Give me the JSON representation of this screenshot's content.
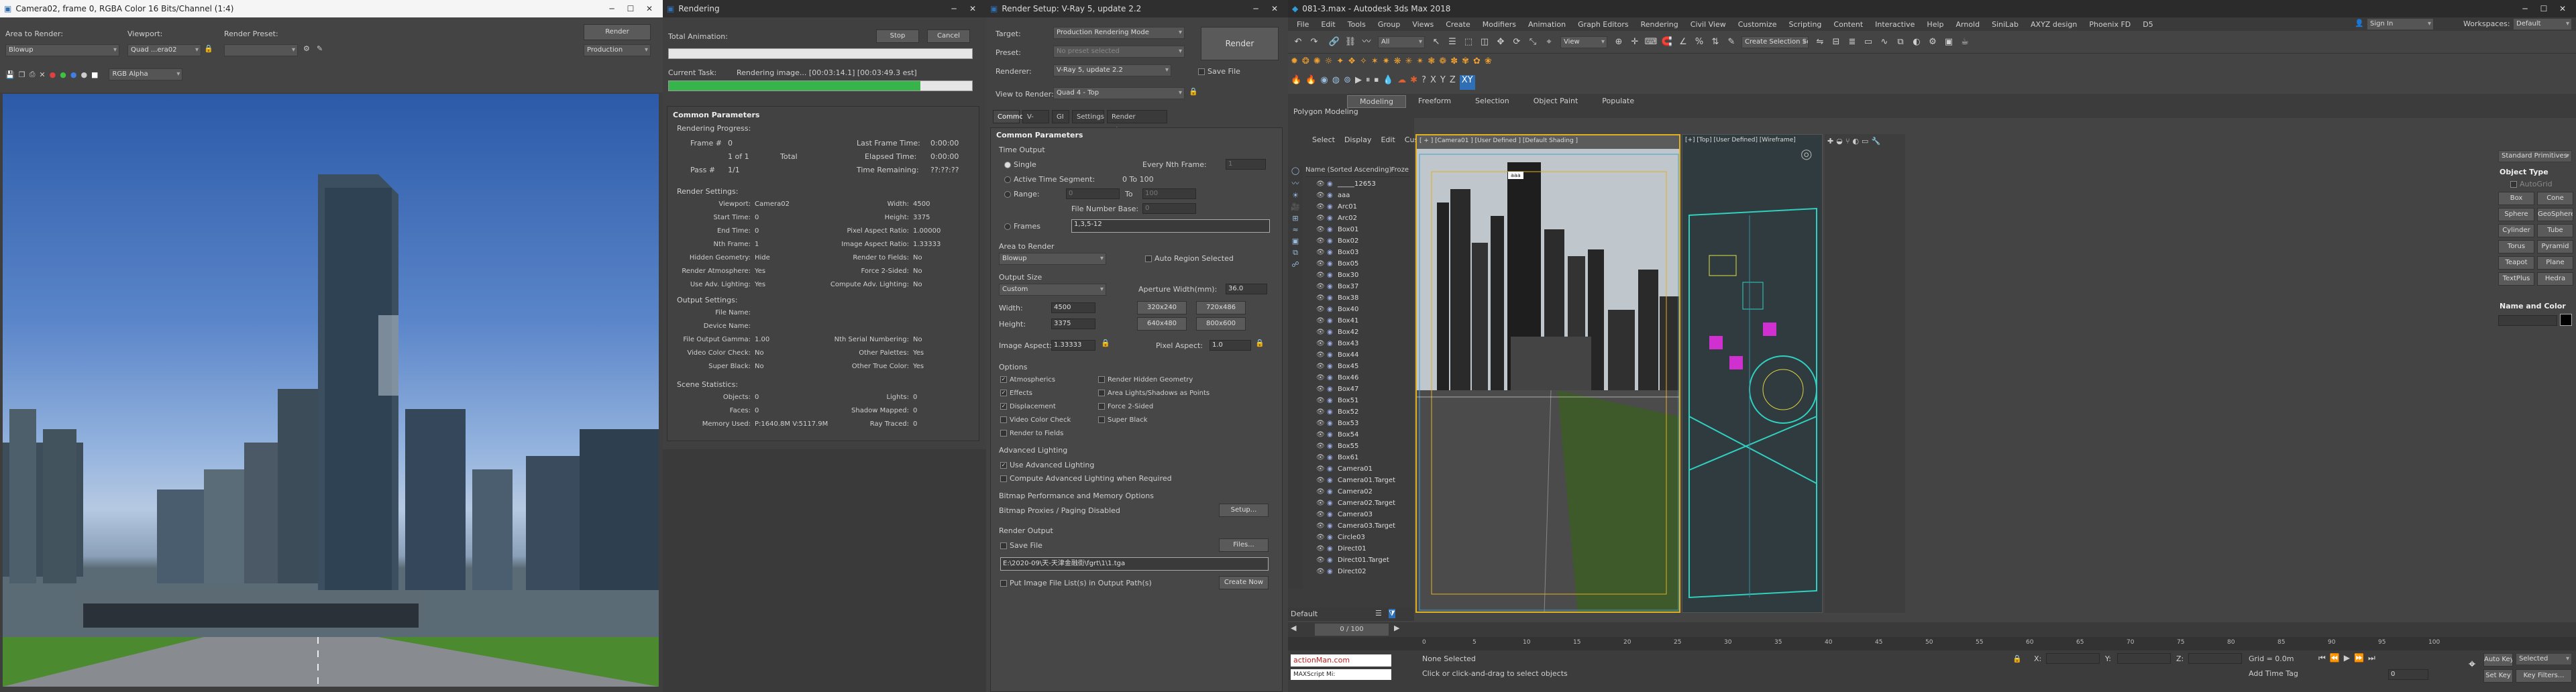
{
  "frame_buffer": {
    "title": "Camera02, frame 0, RGBA Color 16 Bits/Channel (1:4)",
    "area_to_render_label": "Area to Render:",
    "area_to_render_value": "Blowup",
    "viewport_label": "Viewport:",
    "viewport_value": "Quad ...era02",
    "render_preset_label": "Render Preset:",
    "render_preset_value": "",
    "render_button": "Render",
    "production_value": "Production",
    "channel_value": "RGB Alpha"
  },
  "rendering_dialog": {
    "title": "Rendering",
    "total_animation_label": "Total Animation:",
    "stop_button": "Stop",
    "cancel_button": "Cancel",
    "total_progress": 0.0,
    "current_task_label": "Current Task:",
    "current_task_value": "Rendering image... [00:03:14.1] [00:03:49.3 est]",
    "task_progress": 0.83,
    "section_title": "Common Parameters",
    "rendering_progress_label": "Rendering Progress:",
    "frame_label": "Frame #",
    "frame_value": "0",
    "of_value": "1 of 1",
    "total_label": "Total",
    "pass_label": "Pass #",
    "pass_value": "1/1",
    "last_frame_time_label": "Last Frame Time:",
    "last_frame_time_value": "0:00:00",
    "elapsed_time_label": "Elapsed Time:",
    "elapsed_time_value": "0:00:00",
    "time_remaining_label": "Time Remaining:",
    "time_remaining_value": "??:??:??",
    "render_settings_label": "Render Settings:",
    "settings": [
      {
        "k": "Viewport:",
        "v": "Camera02"
      },
      {
        "k": "Start Time:",
        "v": "0"
      },
      {
        "k": "End Time:",
        "v": "0"
      },
      {
        "k": "Nth Frame:",
        "v": "1"
      },
      {
        "k": "Hidden Geometry:",
        "v": "Hide"
      },
      {
        "k": "Render Atmosphere:",
        "v": "Yes"
      },
      {
        "k": "Use Adv. Lighting:",
        "v": "Yes"
      }
    ],
    "settings_right": [
      {
        "k": "Width:",
        "v": "4500"
      },
      {
        "k": "Height:",
        "v": "3375"
      },
      {
        "k": "Pixel Aspect Ratio:",
        "v": "1.00000"
      },
      {
        "k": "Image Aspect Ratio:",
        "v": "1.33333"
      },
      {
        "k": "Render to Fields:",
        "v": "No"
      },
      {
        "k": "Force 2-Sided:",
        "v": "No"
      },
      {
        "k": "Compute Adv. Lighting:",
        "v": "No"
      }
    ],
    "output_settings_label": "Output Settings:",
    "output": [
      {
        "k": "File Name:",
        "v": ""
      },
      {
        "k": "Device Name:",
        "v": ""
      },
      {
        "k": "File Output Gamma:",
        "v": "1.00"
      },
      {
        "k": "Video Color Check:",
        "v": "No"
      },
      {
        "k": "Super Black:",
        "v": "No"
      }
    ],
    "output_right": [
      {
        "k": "Nth Serial Numbering:",
        "v": "No"
      },
      {
        "k": "Other Palettes:",
        "v": "Yes"
      },
      {
        "k": "Other True Color:",
        "v": "Yes"
      }
    ],
    "scene_statistics_label": "Scene Statistics:",
    "scene": [
      {
        "k": "Objects:",
        "v": "0"
      },
      {
        "k": "Faces:",
        "v": "0"
      },
      {
        "k": "Memory Used:",
        "v": "P:1640.8M V:5117.9M"
      }
    ],
    "scene_right": [
      {
        "k": "Lights:",
        "v": "0"
      },
      {
        "k": "Shadow Mapped:",
        "v": "0"
      },
      {
        "k": "Ray Traced:",
        "v": "0"
      }
    ]
  },
  "render_setup": {
    "title": "Render Setup: V-Ray 5, update 2.2",
    "target_label": "Target:",
    "target_value": "Production Rendering Mode",
    "preset_label": "Preset:",
    "preset_value": "No preset selected",
    "renderer_label": "Renderer:",
    "renderer_value": "V-Ray 5, update 2.2",
    "save_file_label": "Save File",
    "view_to_render_label": "View to Render:",
    "view_to_render_value": "Quad 4 - Top",
    "render_button": "Render",
    "tabs": [
      "Common",
      "V-Ray",
      "GI",
      "Settings",
      "Render Elements"
    ],
    "common_params_title": "Common Parameters",
    "time_output_label": "Time Output",
    "single_label": "Single",
    "every_nth_label": "Every Nth Frame:",
    "every_nth_value": "1",
    "active_time_segment_label": "Active Time Segment:",
    "active_time_segment_value": "0 To 100",
    "range_label": "Range:",
    "range_from": "0",
    "range_to_label": "To",
    "range_to": "100",
    "file_number_base_label": "File Number Base:",
    "file_number_base_value": "0",
    "frames_label": "Frames",
    "frames_value": "1,3,5-12",
    "area_to_render_label": "Area to Render",
    "area_value": "Blowup",
    "auto_region_label": "Auto Region Selected",
    "output_size_label": "Output Size",
    "output_size_value": "Custom",
    "aperture_label": "Aperture Width(mm):",
    "aperture_value": "36.0",
    "width_label": "Width:",
    "width_value": "4500",
    "height_label": "Height:",
    "height_value": "3375",
    "presets": [
      "320x240",
      "720x486",
      "640x480",
      "800x600"
    ],
    "image_aspect_label": "Image Aspect:",
    "image_aspect_value": "1.33333",
    "pixel_aspect_label": "Pixel Aspect:",
    "pixel_aspect_value": "1.0",
    "options_label": "Options",
    "options_left": [
      {
        "label": "Atmospherics",
        "checked": true
      },
      {
        "label": "Effects",
        "checked": true
      },
      {
        "label": "Displacement",
        "checked": true
      },
      {
        "label": "Video Color Check",
        "checked": false
      },
      {
        "label": "Render to Fields",
        "checked": false
      }
    ],
    "options_right": [
      {
        "label": "Render Hidden Geometry",
        "checked": false
      },
      {
        "label": "Area Lights/Shadows as Points",
        "checked": false
      },
      {
        "label": "Force 2-Sided",
        "checked": false
      },
      {
        "label": "Super Black",
        "checked": false
      }
    ],
    "adv_lighting_label": "Advanced Lighting",
    "use_adv_lighting_label": "Use Advanced Lighting",
    "compute_adv_lighting_label": "Compute Advanced Lighting when Required",
    "bitmap_perf_label": "Bitmap Performance and Memory Options",
    "bitmap_proxies_label": "Bitmap Proxies / Paging Disabled",
    "setup_button": "Setup...",
    "render_output_label": "Render Output",
    "save_file_chk": "Save File",
    "files_button": "Files...",
    "output_path": "E:\\2020-09\\天-天津金融街\\fgrt\\1\\1.tga",
    "put_image_label": "Put Image File List(s) in Output Path(s)",
    "create_now_button": "Create Now"
  },
  "max": {
    "title": "081-3.max - Autodesk 3ds Max 2018",
    "menu": [
      "File",
      "Edit",
      "Tools",
      "Group",
      "Views",
      "Create",
      "Modifiers",
      "Animation",
      "Graph Editors",
      "Rendering",
      "Civil View",
      "Customize",
      "Scripting",
      "Content",
      "Interactive",
      "Help",
      "Arnold",
      "SiniLab",
      "AXYZ design",
      "Phoenix FD",
      "D5"
    ],
    "sign_in": "Sign In",
    "workspaces_label": "Workspaces:",
    "workspaces_value": "Default",
    "filter_value": "All",
    "view_value": "View",
    "selection_set": "Create Selection Se",
    "ribbon_tabs": [
      "Modeling",
      "Freeform",
      "Selection",
      "Object Paint",
      "Populate"
    ],
    "ribbon_sub": "Polygon Modeling",
    "scene_explorer_menu": [
      "Select",
      "Display",
      "Edit",
      "Customize"
    ],
    "name_column": "Name (Sorted Ascending)",
    "frozen_column": "Froze",
    "objects": [
      "_____12653",
      "aaa",
      "Arc01",
      "Arc02",
      "Box01",
      "Box02",
      "Box03",
      "Box05",
      "Box30",
      "Box37",
      "Box38",
      "Box40",
      "Box41",
      "Box42",
      "Box43",
      "Box44",
      "Box45",
      "Box46",
      "Box47",
      "Box51",
      "Box52",
      "Box53",
      "Box54",
      "Box55",
      "Box61",
      "Camera01",
      "Camera01.Target",
      "Camera02",
      "Camera02.Target",
      "Camera03",
      "Camera03.Target",
      "Circle03",
      "Direct01",
      "Direct01.Target",
      "Direct02"
    ],
    "layer_value": "Default",
    "viewport_left_label": "[ + ] [Camera01 ] [User Defined ] [Default Shading ]",
    "viewport_right_label": "[+] [Top] [User Defined] [Wireframe]",
    "aaa_label": "aaa",
    "timeline_value": "0 / 100",
    "ruler": [
      "0",
      "5",
      "10",
      "15",
      "20",
      "25",
      "30",
      "35",
      "40",
      "45",
      "50",
      "55",
      "60",
      "65",
      "70",
      "75",
      "80",
      "85",
      "90",
      "95",
      "100"
    ],
    "maxscript_label": "MAXScript Mi:",
    "status_none": "None Selected",
    "status_hint": "Click or click-and-drag to select objects",
    "x_label": "X:",
    "y_label": "Y:",
    "z_label": "Z:",
    "grid_label": "Grid = 0.0m",
    "add_time_tag": "Add Time Tag",
    "auto_key": "Auto Key",
    "selected_value": "Selected",
    "set_key": "Set Key",
    "key_filters": "Key Filters...",
    "frame_value": "0",
    "cmd_dropdown": "Standard Primitives",
    "object_type_label": "Object Type",
    "autogrid_label": "AutoGrid",
    "primitives": [
      "Box",
      "Cone",
      "Sphere",
      "GeoSphere",
      "Cylinder",
      "Tube",
      "Torus",
      "Pyramid",
      "Teapot",
      "Plane",
      "TextPlus",
      "Hedra"
    ],
    "name_color_label": "Name and Color",
    "logo_text": "actionMan.com"
  },
  "colors": {
    "accent_blue": "#2e6fb5",
    "progress_green": "#37b44a",
    "viewport_border_yellow": "#e0b020"
  }
}
